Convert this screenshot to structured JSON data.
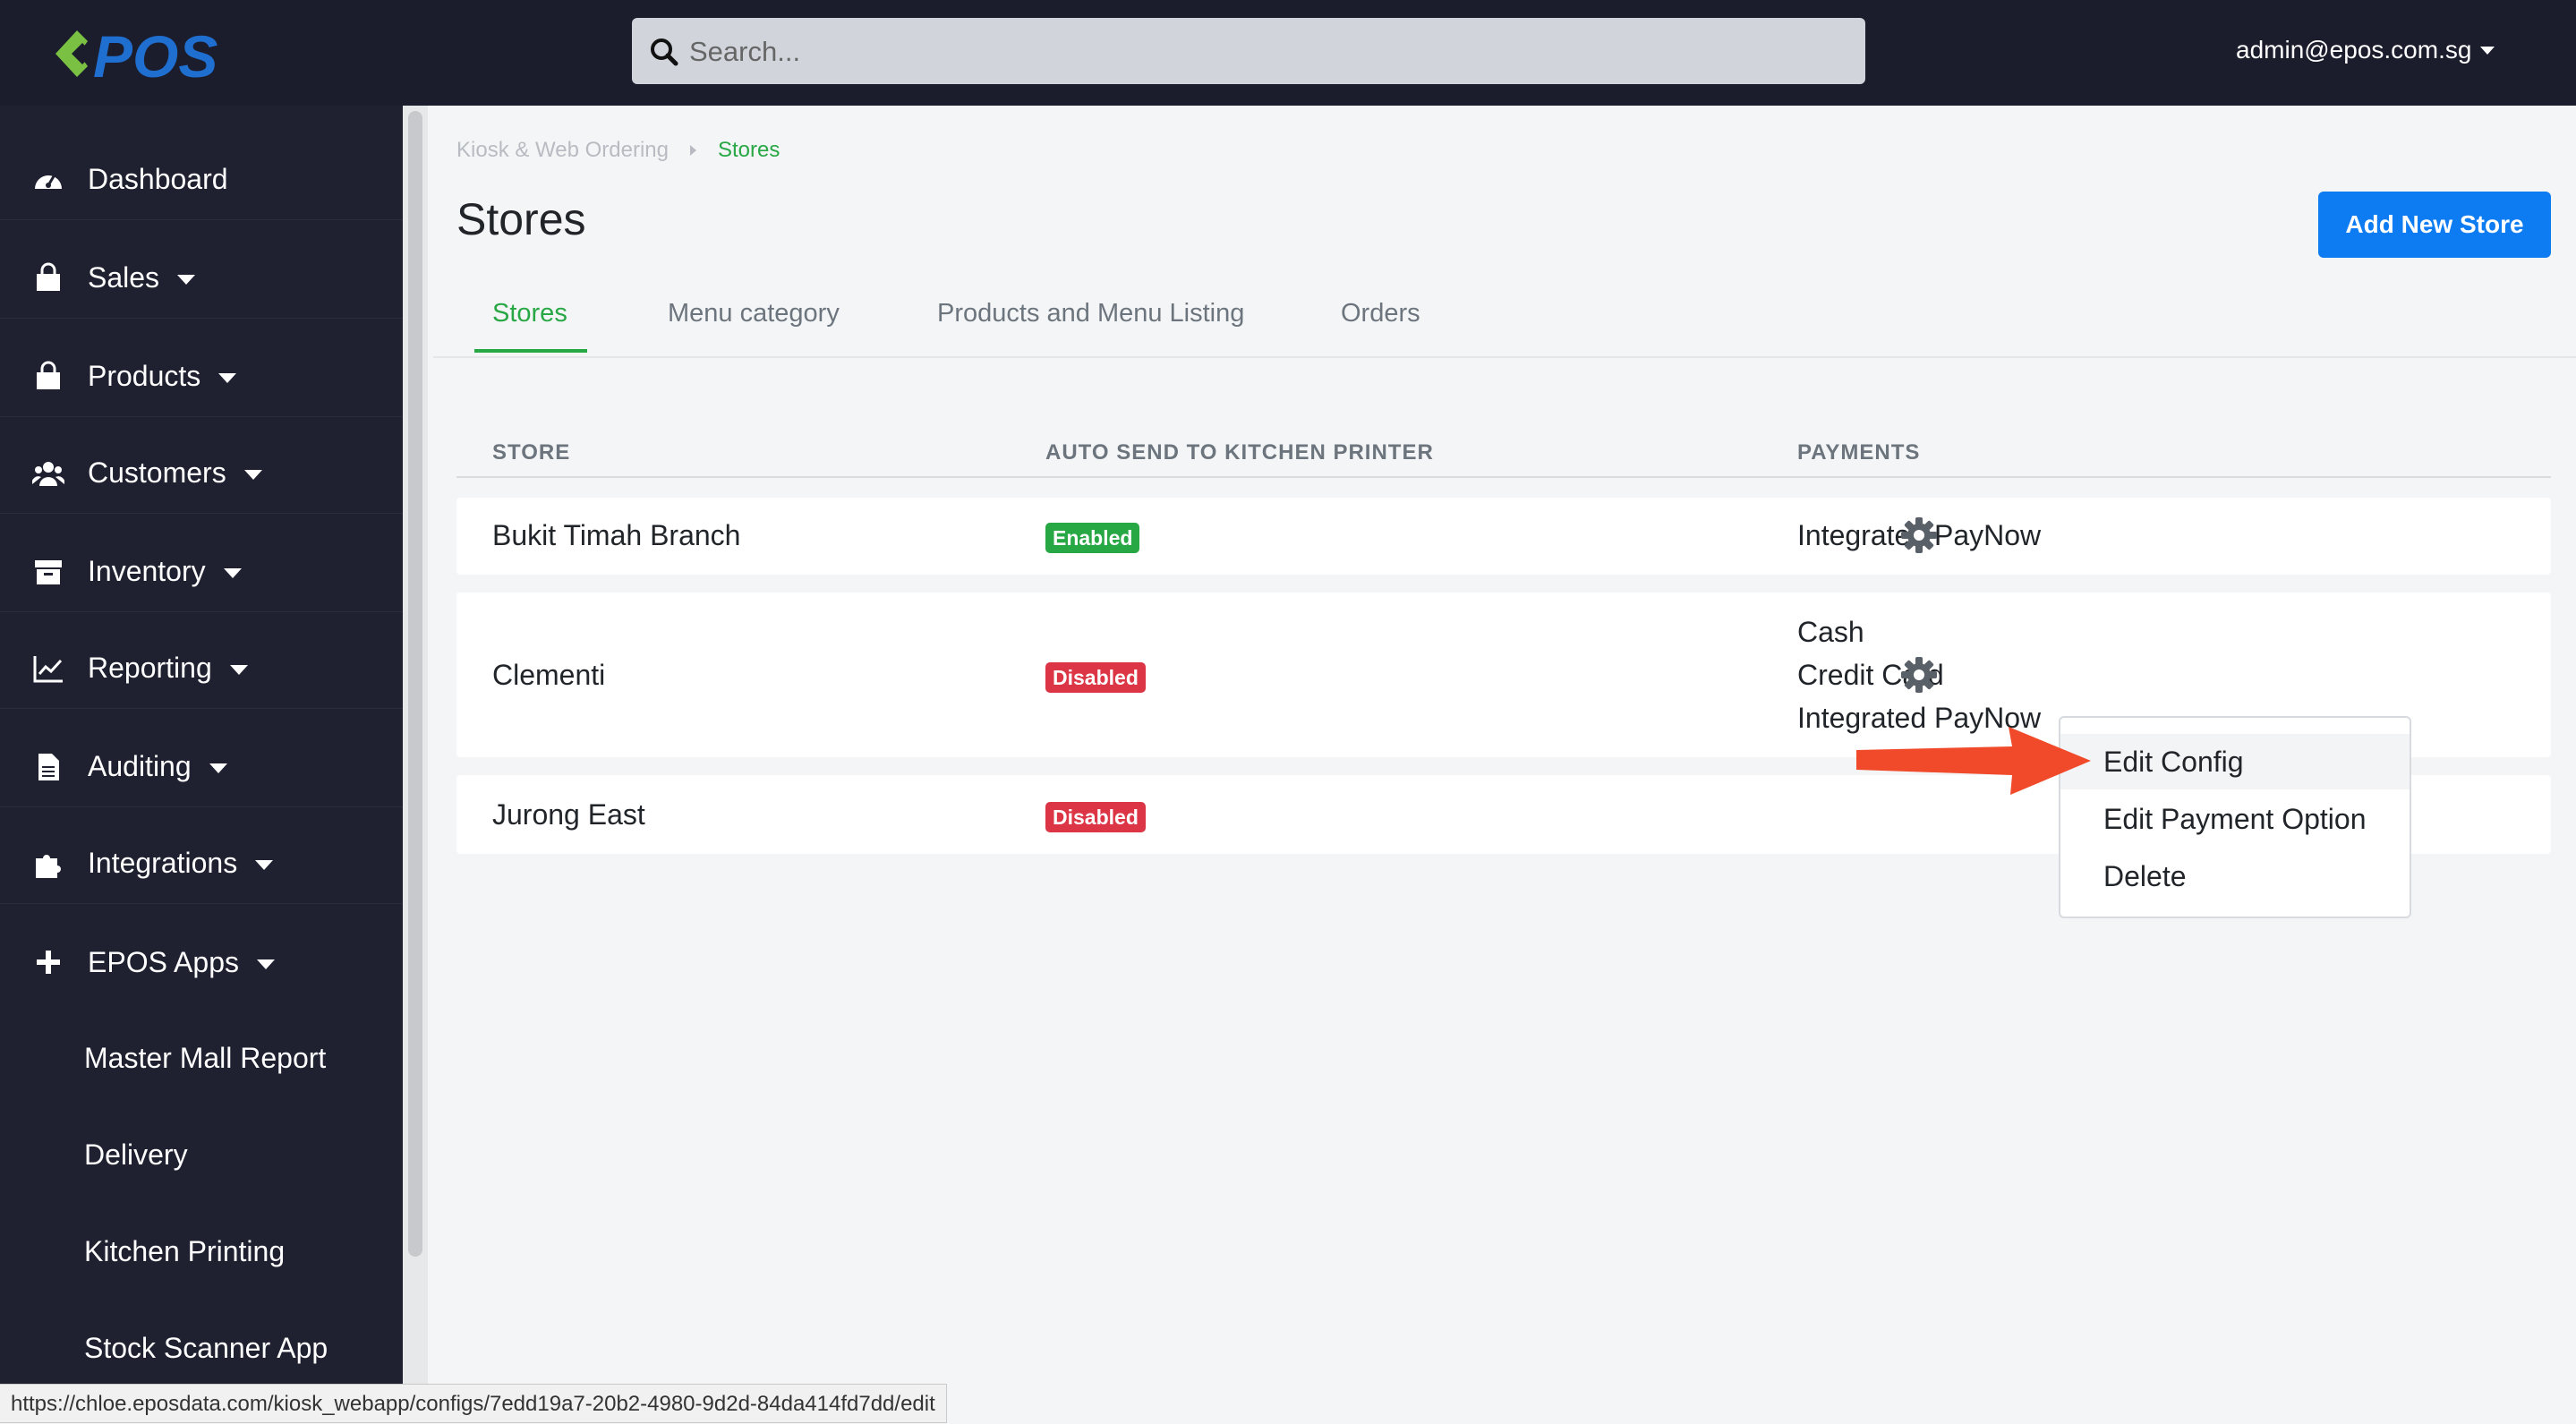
{
  "brand": {
    "name": "EPOS"
  },
  "search": {
    "placeholder": "Search..."
  },
  "user": {
    "email": "admin@epos.com.sg"
  },
  "sidebar": {
    "items": [
      {
        "label": "Dashboard",
        "icon": "dashboard-icon"
      },
      {
        "label": "Sales",
        "icon": "shopping-bag-icon"
      },
      {
        "label": "Products",
        "icon": "shopping-bag-icon"
      },
      {
        "label": "Customers",
        "icon": "users-icon"
      },
      {
        "label": "Inventory",
        "icon": "archive-icon"
      },
      {
        "label": "Reporting",
        "icon": "chart-line-icon"
      },
      {
        "label": "Auditing",
        "icon": "file-icon"
      },
      {
        "label": "Integrations",
        "icon": "puzzle-icon"
      },
      {
        "label": "EPOS Apps",
        "icon": "plus-icon"
      }
    ],
    "sub_items": [
      "Master Mall Report",
      "Delivery",
      "Kitchen Printing",
      "Stock Scanner App"
    ]
  },
  "breadcrumb": {
    "parent": "Kiosk & Web Ordering",
    "current": "Stores"
  },
  "page": {
    "title": "Stores",
    "add_button": "Add New Store"
  },
  "tabs": [
    "Stores",
    "Menu category",
    "Products and Menu Listing",
    "Orders"
  ],
  "table": {
    "headers": [
      "STORE",
      "AUTO SEND TO KITCHEN PRINTER",
      "PAYMENTS"
    ],
    "rows": [
      {
        "store": "Bukit Timah Branch",
        "printer": "Enabled",
        "payments": [
          "Integrated PayNow"
        ]
      },
      {
        "store": "Clementi",
        "printer": "Disabled",
        "payments": [
          "Cash",
          "Credit Card",
          "Integrated PayNow"
        ]
      },
      {
        "store": "Jurong East",
        "printer": "Disabled",
        "payments": []
      }
    ]
  },
  "dropdown": {
    "items": [
      "Edit Config",
      "Edit Payment Option",
      "Delete"
    ]
  },
  "status_url": "https://chloe.eposdata.com/kiosk_webapp/configs/7edd19a7-20b2-4980-9d2d-84da414fd7dd/edit",
  "colors": {
    "accent": "#28a745",
    "primary": "#0d7bf2",
    "danger": "#dc3545",
    "sidebar": "#1f2030",
    "arrow": "#f04a2a"
  }
}
